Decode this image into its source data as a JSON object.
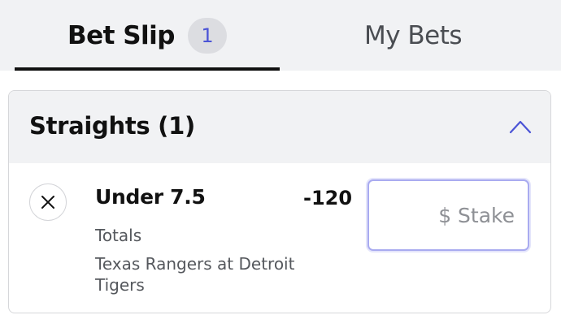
{
  "tabs": {
    "bet_slip": {
      "label": "Bet Slip",
      "count": "1"
    },
    "my_bets": {
      "label": "My Bets"
    }
  },
  "section": {
    "title": "Straights (1)",
    "collapse_icon": "chevron-up-icon"
  },
  "bet": {
    "remove_icon": "close-icon",
    "selection": "Under 7.5",
    "odds": "-120",
    "market": "Totals",
    "event": "Texas Rangers at Detroit Tigers",
    "stake": {
      "value": "",
      "placeholder": "$ Stake"
    }
  },
  "colors": {
    "accent": "#4b54d6",
    "tab_bar_bg": "#f1f2f4",
    "stake_border": "#a9abf0"
  }
}
